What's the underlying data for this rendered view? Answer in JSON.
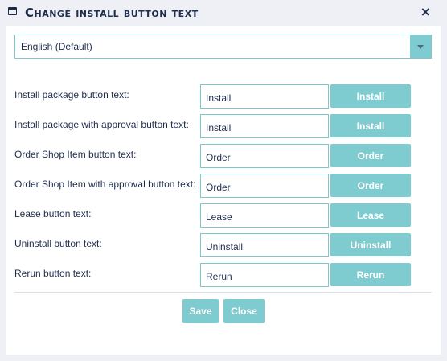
{
  "dialog": {
    "title": "Change install button text",
    "close_symbol": "×",
    "window_icon": "window-icon",
    "close_icon": "close-icon"
  },
  "language_select": {
    "selected": "English (Default)",
    "icon": "chevron-down-icon"
  },
  "rows": [
    {
      "label": "Install package button text:",
      "value": "Install",
      "button": "Install"
    },
    {
      "label": "Install package with approval button text:",
      "value": "Install",
      "button": "Install"
    },
    {
      "label": "Order Shop Item button text:",
      "value": "Order",
      "button": "Order"
    },
    {
      "label": "Order Shop Item with approval button text:",
      "value": "Order",
      "button": "Order"
    },
    {
      "label": "Lease button text:",
      "value": "Lease",
      "button": "Lease"
    },
    {
      "label": "Uninstall button text:",
      "value": "Uninstall",
      "button": "Uninstall"
    },
    {
      "label": "Rerun button text:",
      "value": "Rerun",
      "button": "Rerun"
    }
  ],
  "footer": {
    "save_label": "Save",
    "close_label": "Close"
  },
  "colors": {
    "accent": "#7ecbd0",
    "text": "#1f2d4d",
    "border": "#7cc8cd",
    "background": "#eef0f6"
  }
}
